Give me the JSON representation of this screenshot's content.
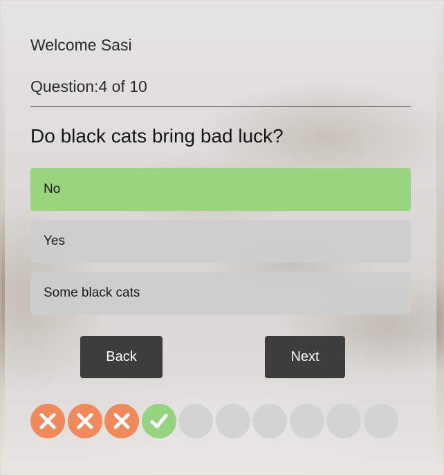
{
  "user": {
    "welcome_text": "Welcome Sasi"
  },
  "quiz": {
    "question_counter": "Question:4 of 10",
    "question": "Do black cats bring bad luck?",
    "options": [
      {
        "label": "No",
        "selected": true
      },
      {
        "label": "Yes",
        "selected": false
      },
      {
        "label": "Some black cats",
        "selected": false
      }
    ]
  },
  "navigation": {
    "back_label": "Back",
    "next_label": "Next"
  },
  "progress": {
    "results": [
      "wrong",
      "wrong",
      "wrong",
      "correct",
      "unanswered",
      "unanswered",
      "unanswered",
      "unanswered",
      "unanswered",
      "unanswered"
    ],
    "icons": {
      "wrong": "x-mark-icon",
      "correct": "check-mark-icon"
    }
  },
  "colors": {
    "selected_option": "#9bd47e",
    "option": "#cdcdcd",
    "button": "#3d3d3d",
    "wrong": "#f08a5d",
    "correct": "#95d37e",
    "unanswered": "#d3d3d3"
  }
}
